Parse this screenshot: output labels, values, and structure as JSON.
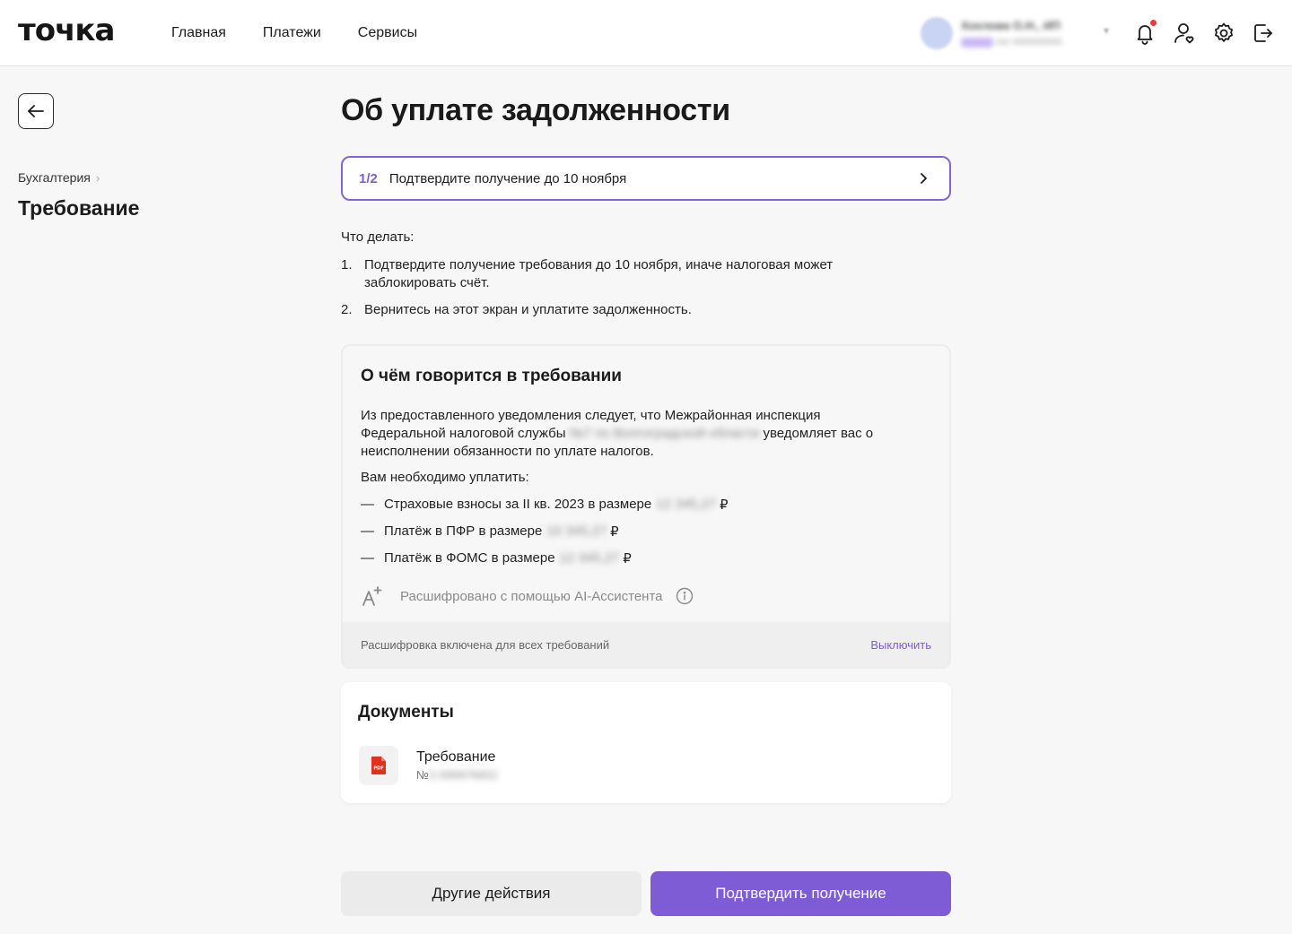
{
  "header": {
    "logo": "точка",
    "nav": [
      "Главная",
      "Платежи",
      "Сервисы"
    ],
    "profile": {
      "name": "Хохлова О.Н., ИП",
      "subtitle": "inn 000000000"
    },
    "icons": [
      "bell-icon",
      "user-heart-icon",
      "gear-icon",
      "logout-icon"
    ],
    "notification_dot_color": "#e53b3b"
  },
  "sidebar": {
    "breadcrumb": "Бухгалтерия",
    "title": "Требование"
  },
  "main": {
    "title": "Об уплате задолженности",
    "step": {
      "counter": "1/2",
      "text": "Подтвердите получение до 10 ноября"
    },
    "todo": {
      "label": "Что делать:",
      "items": [
        {
          "num": "1.",
          "text": "Подтвердите получение требования до 10 ноября, иначе налоговая может заблокировать счёт."
        },
        {
          "num": "2.",
          "text": "Вернитесь на этот экран и уплатите задолженность."
        }
      ]
    },
    "summary": {
      "title": "О чём говорится в требовании",
      "para_before": "Из предоставленного уведомления следует, что Межрайонная инспекция Федеральной налоговой службы",
      "para_hidden": "№7 по Волгоградской области",
      "para_after": "уведомляет вас о неисполнении обязанности по уплате налогов.",
      "need": "Вам необходимо уплатить:",
      "dash": "—",
      "currency": "₽",
      "payments": [
        {
          "text": "Страховые взносы за II кв. 2023 в размере",
          "amount": "12 345,27"
        },
        {
          "text": "Платёж в ПФР в размере",
          "amount": "10 345,27"
        },
        {
          "text": "Платёж в ФОМС в размере",
          "amount": "12 345,27"
        }
      ],
      "ai_note": "Расшифровано с помощью AI-Ассистента",
      "footer_text": "Расшифровка включена для всех требований",
      "footer_link": "Выключить"
    },
    "documents": {
      "title": "Документы",
      "items": [
        {
          "name": "Требование",
          "num_prefix": "№",
          "num_hidden": "2-099976652"
        }
      ]
    },
    "buttons": {
      "secondary": "Другие действия",
      "primary": "Подтвердить получение"
    }
  },
  "colors": {
    "accent": "#7e5cd6",
    "pdf_red": "#e0301e"
  }
}
